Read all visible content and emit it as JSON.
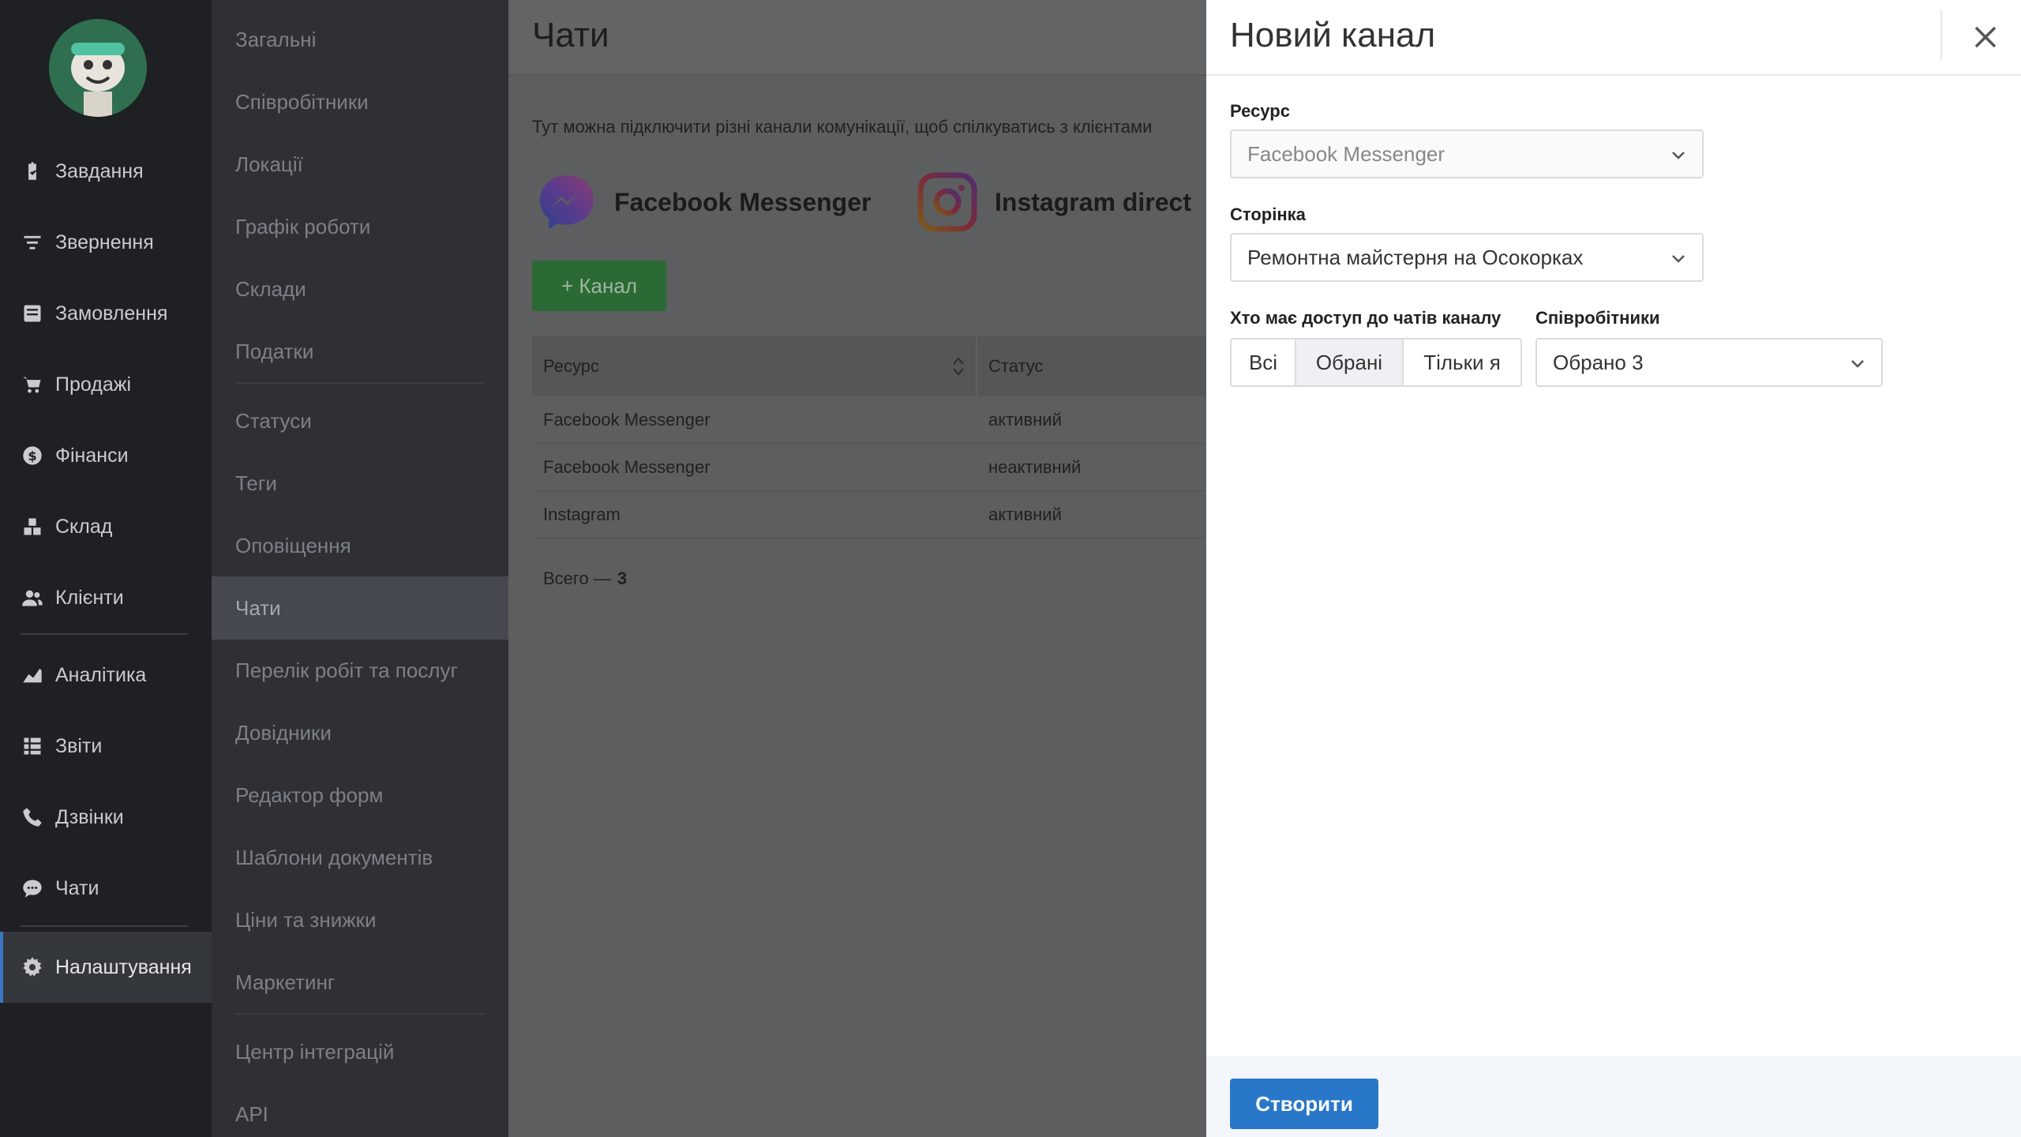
{
  "sidebar": {
    "items": [
      {
        "label": "Завдання",
        "icon": "clipboard-icon"
      },
      {
        "label": "Звернення",
        "icon": "filter-icon"
      },
      {
        "label": "Замовлення",
        "icon": "order-icon"
      },
      {
        "label": "Продажі",
        "icon": "cart-icon"
      },
      {
        "label": "Фінанси",
        "icon": "dollar-icon"
      },
      {
        "label": "Склад",
        "icon": "boxes-icon"
      },
      {
        "label": "Клієнти",
        "icon": "users-icon"
      },
      {
        "label": "Аналітика",
        "icon": "chart-area-icon"
      },
      {
        "label": "Звіти",
        "icon": "table-icon"
      },
      {
        "label": "Дзвінки",
        "icon": "phone-icon"
      },
      {
        "label": "Чати",
        "icon": "chat-icon"
      },
      {
        "label": "Налаштування",
        "icon": "gear-icon"
      }
    ],
    "active": "Налаштування"
  },
  "submenu": {
    "items": [
      "Загальні",
      "Співробітники",
      "Локації",
      "Графік роботи",
      "Склади",
      "Податки",
      "Статуси",
      "Теги",
      "Оповіщення",
      "Чати",
      "Перелік робіт та послуг",
      "Довідники",
      "Редактор форм",
      "Шаблони документів",
      "Ціни та знижки",
      "Маркетинг",
      "Центр інтеграцій",
      "API"
    ],
    "active": "Чати"
  },
  "main": {
    "title": "Чати",
    "description": "Тут можна підключити різні канали комунікації, щоб спілкуватись з клієнтами",
    "providers": [
      "Facebook Messenger",
      "Instagram direct"
    ],
    "add_button": "+ Канал",
    "table": {
      "columns": [
        "Ресурс",
        "Статус"
      ],
      "rows": [
        [
          "Facebook Messenger",
          "активний"
        ],
        [
          "Facebook Messenger",
          "неактивний"
        ],
        [
          "Instagram",
          "активний"
        ]
      ]
    },
    "total_label": "Всего —",
    "total_count": "3"
  },
  "panel": {
    "title": "Новий канал",
    "resource_label": "Ресурс",
    "resource_value": "Facebook Messenger",
    "page_label": "Сторінка",
    "page_value": "Ремонтна майстерня на Осокорках",
    "access_label": "Хто має доступ до чатів каналу",
    "access_options": [
      "Всі",
      "Обрані",
      "Тільки я"
    ],
    "access_selected": "Обрані",
    "employees_label": "Співробітники",
    "employees_value": "Обрано 3",
    "create_button": "Створити"
  },
  "colors": {
    "accent": "#2977c9",
    "sidebar_bg": "#1e2023",
    "add_button": "#2b6a34"
  }
}
